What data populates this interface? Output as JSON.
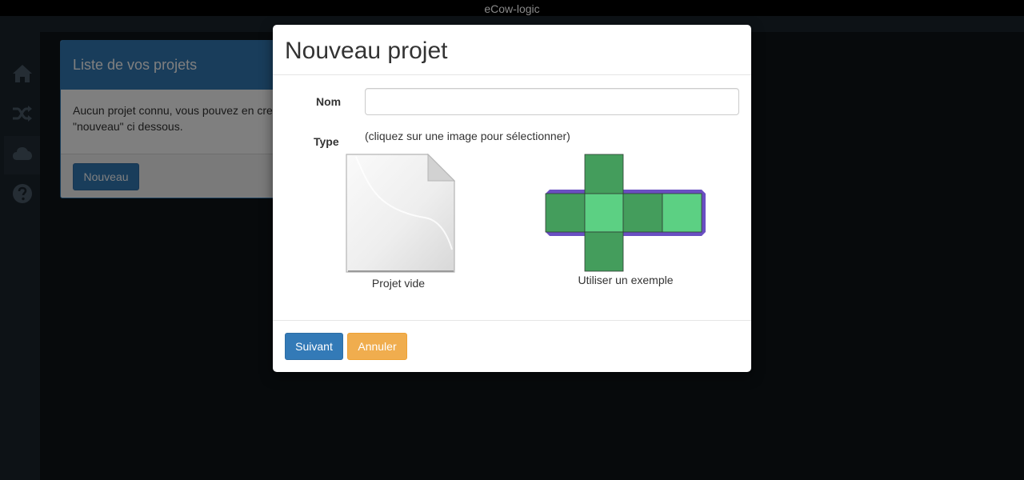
{
  "app": {
    "title": "eCow-logic"
  },
  "sidebar": {
    "items": [
      {
        "icon": "home-icon"
      },
      {
        "icon": "shuffle-icon"
      },
      {
        "icon": "cloud-icon",
        "active": true
      },
      {
        "icon": "question-circle-icon"
      }
    ]
  },
  "panel": {
    "heading": "Liste de vos projets",
    "body_line1": "Aucun projet connu, vous pouvez en cre",
    "body_line2": "\"nouveau\" ci dessous.",
    "new_button": "Nouveau"
  },
  "modal": {
    "title": "Nouveau projet",
    "name_label": "Nom",
    "name_value": "",
    "type_label": "Type",
    "type_hint": "(cliquez sur une image pour sélectionner)",
    "choices": {
      "empty": "Projet vide",
      "example": "Utiliser un exemple"
    },
    "next_button": "Suivant",
    "cancel_button": "Annuler"
  },
  "colors": {
    "primary": "#337ab7",
    "warning": "#f0ad4e",
    "cube_dark": "#449d5c",
    "cube_light": "#5cd083",
    "cube_edge": "#6a4fc2"
  }
}
